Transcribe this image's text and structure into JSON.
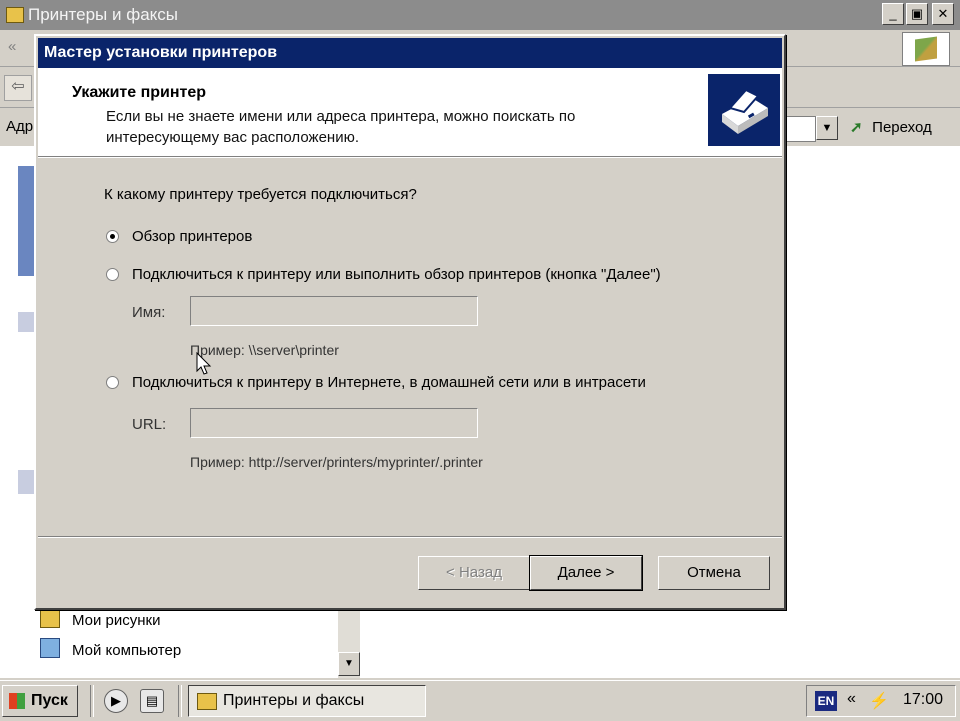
{
  "window": {
    "title": "Принтеры и факсы",
    "controls": {
      "minimize": "_",
      "maximize": "▣",
      "close": "✕"
    },
    "address_label": "Адр",
    "go_label": "Переход"
  },
  "sidebar": {
    "items": [
      {
        "label": "Мои рисунки",
        "icon": "folder-pictures-icon"
      },
      {
        "label": "Мой компьютер",
        "icon": "my-computer-icon"
      }
    ]
  },
  "dialog": {
    "title": "Мастер установки принтеров",
    "header_title": "Укажите принтер",
    "header_subtitle": "Если вы не знаете имени или адреса принтера, можно поискать по интересующему вас расположению.",
    "question": "К какому принтеру требуется подключиться?",
    "options": [
      {
        "label": "Обзор принтеров",
        "checked": true
      },
      {
        "label": "Подключиться к принтеру или выполнить обзор принтеров (кнопка \"Далее\")",
        "checked": false
      },
      {
        "label": "Подключиться к принтеру в Интернете, в домашней сети или в интрасети",
        "checked": false
      }
    ],
    "name_field": {
      "label": "Имя:",
      "value": "",
      "example": "Пример: \\\\server\\printer"
    },
    "url_field": {
      "label": "URL:",
      "value": "",
      "example": "Пример: http://server/printers/myprinter/.printer"
    },
    "buttons": {
      "back": "< Назад",
      "next": "Далее >",
      "cancel": "Отмена"
    }
  },
  "taskbar": {
    "start_label": "Пуск",
    "task_label": "Принтеры и факсы",
    "language": "EN",
    "chevron": "«",
    "clock": "17:00"
  },
  "colors": {
    "dialog_title_bg": "#0a246a",
    "face": "#d4d0c8",
    "inactive_title_bg": "#8c8c8c"
  }
}
